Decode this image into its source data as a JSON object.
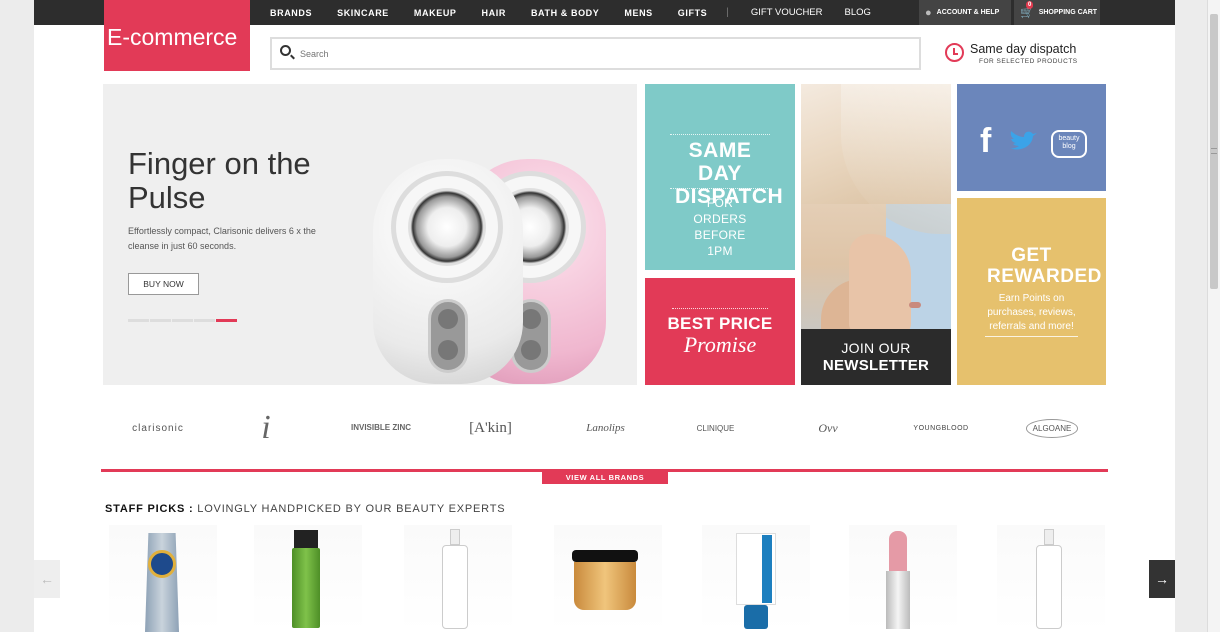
{
  "logo": {
    "text": "E-commerce"
  },
  "nav": {
    "categories": [
      "BRANDS",
      "SKINCARE",
      "MAKEUP",
      "HAIR",
      "BATH & BODY",
      "MENS",
      "GIFTS"
    ],
    "separator": "|",
    "links": [
      "GIFT VOUCHER",
      "BLOG"
    ],
    "account_label": "ACCOUNT & HELP",
    "cart_label": "SHOPPING CART",
    "cart_count": "0"
  },
  "search": {
    "placeholder": "Search"
  },
  "dispatch": {
    "title": "Same day dispatch",
    "subtitle": "FOR SELECTED PRODUCTS"
  },
  "hero": {
    "title": "Finger on the Pulse",
    "description": "Effortlessly compact, Clarisonic delivers 6 x the cleanse in just 60 seconds.",
    "button": "BUY NOW",
    "slide_count": 5,
    "active_slide": 5
  },
  "tiles": {
    "dispatch": {
      "heading": "SAME DAY DISPATCH",
      "sub": "FOR ORDERS BEFORE 1PM"
    },
    "price": {
      "heading": "BEST PRICE",
      "script": "Promise"
    },
    "newsletter": {
      "line1": "JOIN OUR",
      "line2": "NEWSLETTER"
    },
    "social": {
      "facebook": "f",
      "blog": "beauty blog"
    },
    "rewards": {
      "heading": "GET REWARDED",
      "sub": "Earn Points on purchases, reviews, referrals and more!"
    }
  },
  "brands": {
    "clarisonic": "clarisonic",
    "jane": "i",
    "invisible_zinc": "INVISIBLE ZINC",
    "akin": "[A'kin]",
    "lanolips": "Lanolips",
    "clinique": "CLINIQUE",
    "ovv": "Ovv",
    "youngblood": "YOUNGBLOOD",
    "algoane": "ALGOANE"
  },
  "view_all_brands": "VIEW ALL BRANDS",
  "staff_picks": {
    "title": "STAFF PICKS :",
    "subtitle": "LOVINGLY HANDPICKED BY OUR BEAUTY EXPERTS"
  },
  "products": [
    {
      "name": "hand-cream-tube",
      "color": "#8fa4b8"
    },
    {
      "name": "hair-volume-spray",
      "color": "#6cae3c"
    },
    {
      "name": "asap-lotion",
      "color": "#ffffff"
    },
    {
      "name": "redken-mask",
      "color": "#d9a558"
    },
    {
      "name": "dermalogica-tube",
      "color": "#1d7fbf"
    },
    {
      "name": "lipstick",
      "color": "#e59aa6"
    },
    {
      "name": "asap-cleanser",
      "color": "#ffffff"
    }
  ],
  "colors": {
    "accent": "#e23a57",
    "topbar": "#2d2d2d",
    "teal": "#7fcac8",
    "blue": "#6b86bb",
    "gold": "#e6c16d"
  }
}
